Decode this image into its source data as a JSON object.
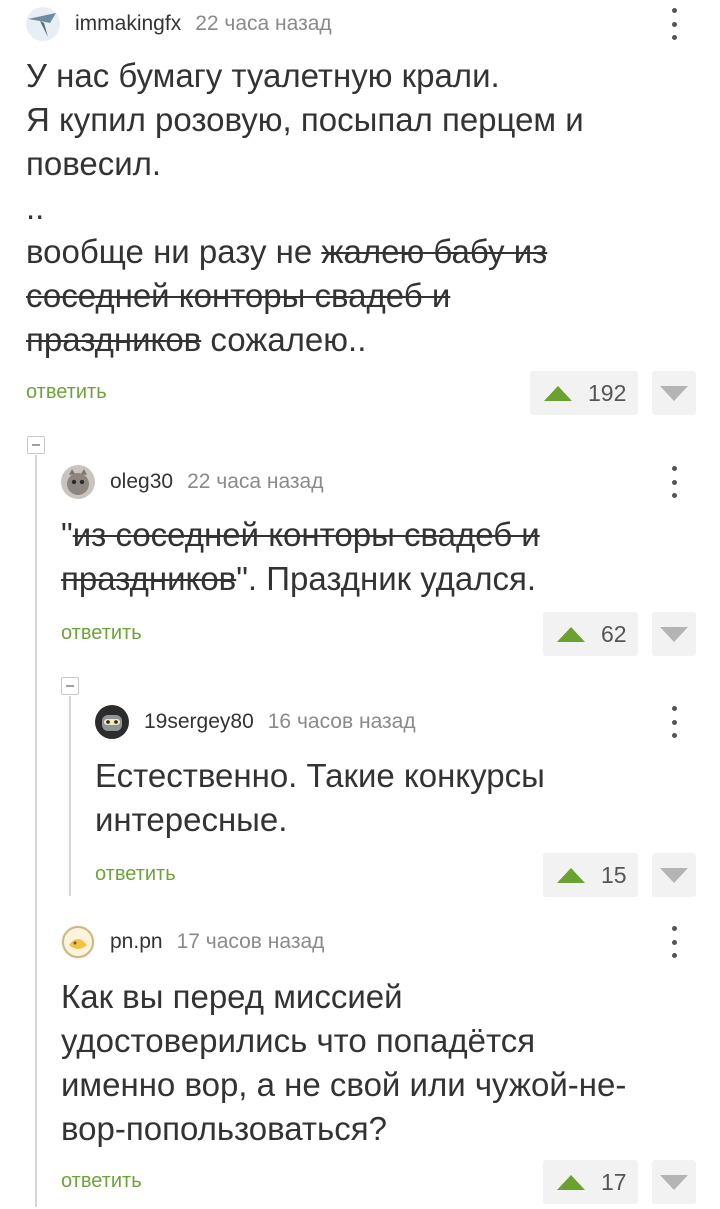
{
  "comments": [
    {
      "author": "immakingfx",
      "time": "22 часа назад",
      "line1": "У нас бумагу туалетную крали.",
      "line2": "Я купил розовую, посыпал перцем и",
      "line3": "повесил.",
      "line4": "..",
      "line5_plain": "вообще ни разу не ",
      "line5_strike": "жалею бабу из",
      "line6_strike": "соседней конторы свадеб и",
      "line7_strike": "праздников",
      "line7_plain": " сожалею..",
      "reply": "ответить",
      "votes": "192"
    },
    {
      "author": "oleg30",
      "time": "22 часа назад",
      "quote_open": "\"",
      "line1_strike": "из соседней конторы свадеб и",
      "line2_strike": "праздников",
      "line2_plain": "\". Праздник удался.",
      "reply": "ответить",
      "votes": "62"
    },
    {
      "author": "19sergey80",
      "time": "16 часов назад",
      "line1": "Естественно. Такие конкурсы",
      "line2": "интересные.",
      "reply": "ответить",
      "votes": "15"
    },
    {
      "author": "pn.pn",
      "time": "17 часов назад",
      "line1": "Как вы перед миссией",
      "line2": "удостоверились что попадётся",
      "line3": "именно вор, а не свой или чужой-не-",
      "line4": "вор-попользоваться?",
      "reply": "ответить",
      "votes": "17"
    }
  ],
  "icons": {
    "upvote": "triangle-up-icon",
    "downvote": "triangle-down-icon",
    "menu": "kebab-menu-icon",
    "collapse": "minus-square-icon"
  },
  "colors": {
    "accent_green": "#6ea339",
    "upvote_green": "#6aa12f",
    "text": "#333333",
    "muted": "#8a8a8a"
  }
}
